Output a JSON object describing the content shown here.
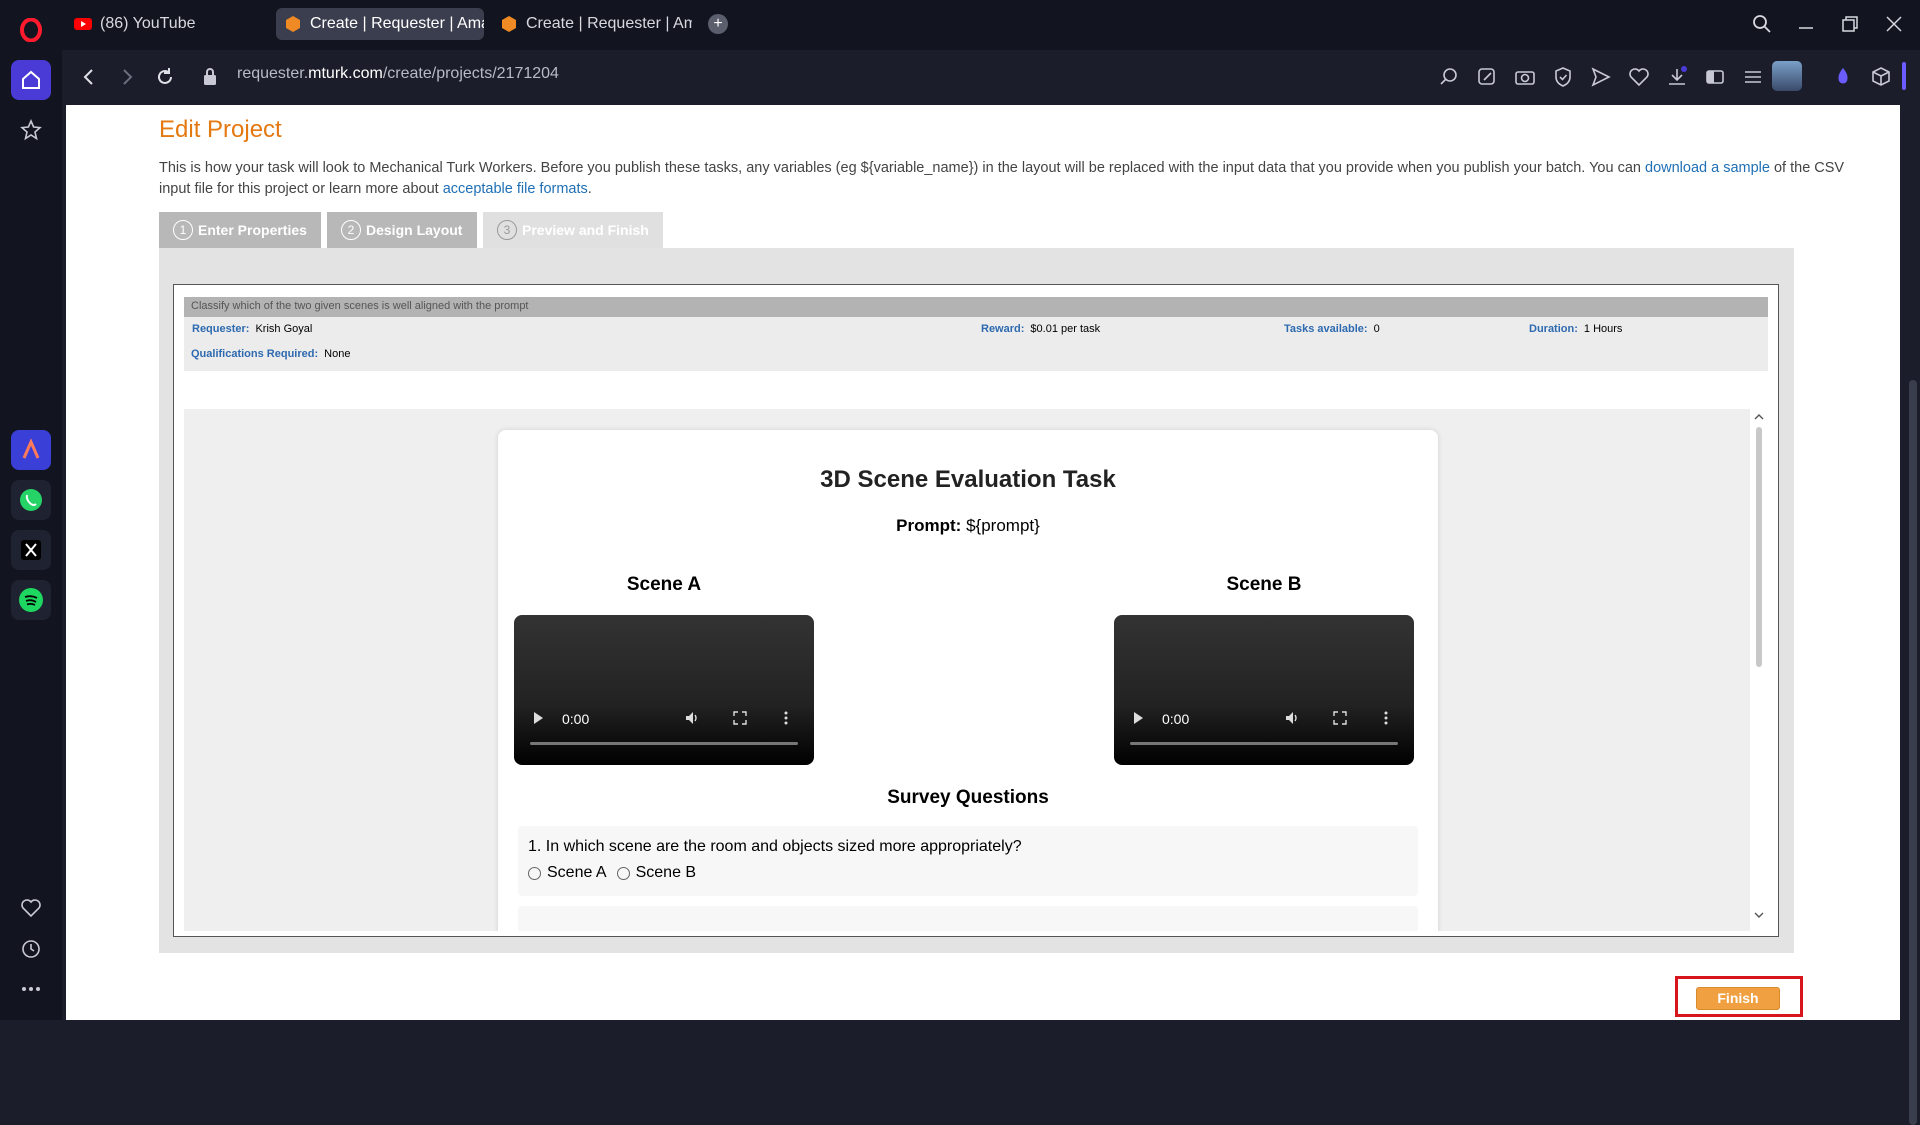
{
  "browser": {
    "tabs": [
      {
        "label": "(86) YouTube",
        "icon": "youtube-icon"
      },
      {
        "label": "Create | Requester | Amaz",
        "icon": "mturk-icon",
        "active": true
      },
      {
        "label": "Create | Requester | Amaz",
        "icon": "mturk-icon"
      }
    ],
    "url_prefix": "requester.",
    "url_domain": "mturk.com",
    "url_path": "/create/projects/2171204"
  },
  "page": {
    "title": "Edit Project",
    "desc_before": "This is how your task will look to Mechanical Turk Workers. Before you publish these tasks, any variables (eg ${variable_name}) in the layout will be replaced with the input data that you provide when you publish your batch. You can ",
    "desc_link1": "download a sample",
    "desc_middle": " of the CSV input file for this project or learn more about ",
    "desc_link2": "acceptable file formats",
    "desc_after": ".",
    "steps": [
      {
        "num": "1",
        "label": "Enter Properties"
      },
      {
        "num": "2",
        "label": "Design Layout"
      },
      {
        "num": "3",
        "label": "Preview and Finish"
      }
    ],
    "finish_label": "Finish"
  },
  "hit": {
    "title": "Classify which of the two given scenes is well aligned with the prompt",
    "requester_key": "Requester:",
    "requester_val": "Krish Goyal",
    "reward_key": "Reward:",
    "reward_val": "$0.01 per task",
    "tasks_key": "Tasks available:",
    "tasks_val": "0",
    "duration_key": "Duration:",
    "duration_val": "1 Hours",
    "quals_key": "Qualifications Required:",
    "quals_val": "None"
  },
  "task": {
    "heading": "3D Scene Evaluation Task",
    "prompt_label": "Prompt:",
    "prompt_value": "${prompt}",
    "scene_a": "Scene A",
    "scene_b": "Scene B",
    "video_time": "0:00",
    "survey_heading": "Survey Questions",
    "q1": "1. In which scene are the room and objects sized more appropriately?",
    "q1_opt_a": "Scene A",
    "q1_opt_b": "Scene B"
  },
  "colors": {
    "accent_orange": "#e47911",
    "link_blue": "#1f6fb5",
    "finish_highlight": "#d6161c"
  }
}
